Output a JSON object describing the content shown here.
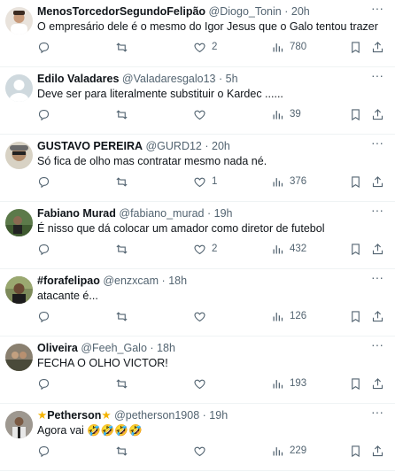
{
  "tweets": [
    {
      "name": "MenosTorcedorSegundoFelipão",
      "handle": "@Diogo_Tonin",
      "time": "20h",
      "text": "O empresário dele é o mesmo do Igor Jesus que o Galo tentou trazer",
      "replies": "",
      "retweets": "",
      "likes": "2",
      "views": "780"
    },
    {
      "name": "Edilo Valadares",
      "handle": "@Valadaresgalo13",
      "time": "5h",
      "text": "Deve ser para literalmente substituir o Kardec ......",
      "replies": "",
      "retweets": "",
      "likes": "",
      "views": "39"
    },
    {
      "name": "GUSTAVO PEREIRA",
      "handle": "@GURD12",
      "time": "20h",
      "text": "Só fica de olho mas contratar mesmo nada né.",
      "replies": "",
      "retweets": "",
      "likes": "1",
      "views": "376"
    },
    {
      "name": "Fabiano Murad",
      "handle": "@fabiano_murad",
      "time": "19h",
      "text": "É nisso que dá colocar um amador como diretor de futebol",
      "replies": "",
      "retweets": "",
      "likes": "2",
      "views": "432"
    },
    {
      "name": "#forafelipao",
      "handle": "@enzxcam",
      "time": "18h",
      "text": "atacante é...",
      "replies": "",
      "retweets": "",
      "likes": "",
      "views": "126"
    },
    {
      "name": "Oliveira",
      "handle": "@Feeh_Galo",
      "time": "18h",
      "text": "FECHA O OLHO VICTOR!",
      "replies": "",
      "retweets": "",
      "likes": "",
      "views": "193"
    },
    {
      "name": "Petherson",
      "name_prefix": "★",
      "name_suffix": "★",
      "handle": "@petherson1908",
      "time": "19h",
      "text": "Agora vai 🤣🤣🤣🤣",
      "replies": "",
      "retweets": "",
      "likes": "",
      "views": "229"
    }
  ],
  "separator": "·",
  "icons": {
    "reply": "reply-icon",
    "retweet": "retweet-icon",
    "like": "heart-icon",
    "views": "views-icon",
    "bookmark": "bookmark-icon",
    "share": "share-icon",
    "more": "more-icon"
  },
  "colors": {
    "text": "#0f1419",
    "secondary": "#536471",
    "divider": "#eff3f4",
    "star": "#f5b400"
  }
}
